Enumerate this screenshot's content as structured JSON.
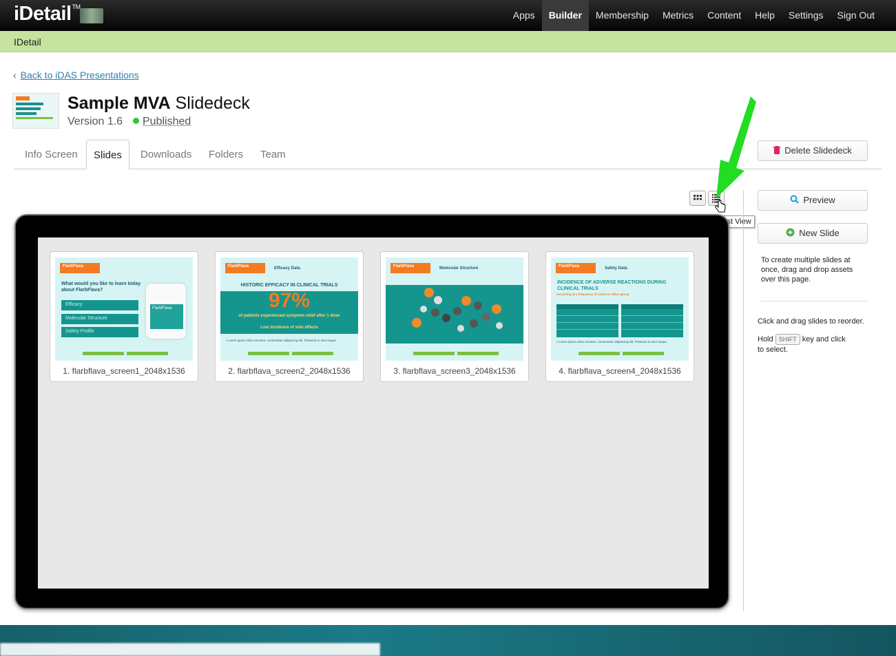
{
  "header": {
    "logo": "iDetail",
    "logo_tm": "TM",
    "nav": [
      "Apps",
      "Builder",
      "Membership",
      "Metrics",
      "Content",
      "Help",
      "Settings",
      "Sign Out"
    ],
    "active_nav": "Builder"
  },
  "subheader": {
    "label": "IDetail"
  },
  "breadcrumb": {
    "back_label": "Back to iDAS Presentations"
  },
  "deck": {
    "title_bold": "Sample MVA",
    "title_rest": "Slidedeck",
    "version": "Version 1.6",
    "status": "Published",
    "status_color": "#32c832"
  },
  "tabs": [
    "Info Screen",
    "Slides",
    "Downloads",
    "Folders",
    "Team"
  ],
  "active_tab": "Slides",
  "actions": {
    "delete": "Delete Slidedeck",
    "preview": "Preview",
    "new_slide": "New Slide"
  },
  "view_toggle": {
    "grid_icon": "grid-icon",
    "list_icon": "list-icon",
    "tooltip": "List View"
  },
  "slides": [
    {
      "caption": "1. flarbflava_screen1_2048x1536",
      "logo": "FlarbFlava",
      "question": "What would you like to learn today about FlarbFlava?",
      "items": [
        "Efficacy",
        "Molecular Structure",
        "Safety Profile"
      ],
      "bottle_label": "FlarbFlava"
    },
    {
      "caption": "2. flarbflava_screen2_2048x1536",
      "logo": "FlarbFlava",
      "section": "Efficacy Data",
      "headline": "HISTORIC EFFICACY IN CLINICAL TRIALS",
      "stat": "97%",
      "stat_text": "of patients experienced symptom relief after 1 dose",
      "stat_sub": "Low incidence of side effects"
    },
    {
      "caption": "3. flarbflava_screen3_2048x1536",
      "logo": "FlarbFlava",
      "section": "Molecular Structure"
    },
    {
      "caption": "4. flarbflava_screen4_2048x1536",
      "logo": "FlarbFlava",
      "section": "Safety Data",
      "headline": "INCIDENCE OF ADVERSE REACTIONS DURING CLINICAL TRIALS",
      "sub": "Occurring at a frequency of ≤2.0% in either group"
    }
  ],
  "help": {
    "multi": "To create multiple slides at once, drag and drop assets over this page.",
    "reorder": "Click and drag slides to reorder.",
    "hold": "Hold",
    "key": "SHIFT",
    "key_rest": "key and click",
    "select": "to select."
  },
  "colors": {
    "accent_green": "#c6e3a0",
    "teal": "#14968f",
    "orange": "#f47b20",
    "link": "#2e7fb3",
    "arrow": "#22dd22"
  }
}
